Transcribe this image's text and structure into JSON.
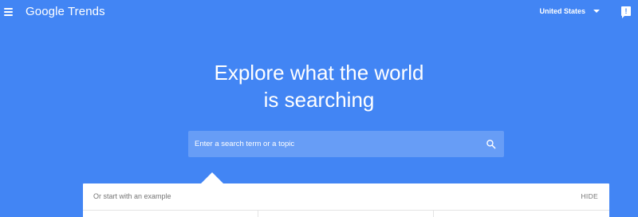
{
  "header": {
    "logo_text": "Google Trends",
    "country": "United States",
    "feedback_glyph": "!"
  },
  "hero": {
    "line1": "Explore what the world",
    "line2": "is searching"
  },
  "search": {
    "placeholder": "Enter a search term or a topic",
    "icon": "search-icon"
  },
  "examples": {
    "label": "Or start with an example",
    "hide_label": "HIDE"
  },
  "colors": {
    "background": "#4285f4",
    "panel": "#ffffff",
    "muted_text": "#757575"
  }
}
